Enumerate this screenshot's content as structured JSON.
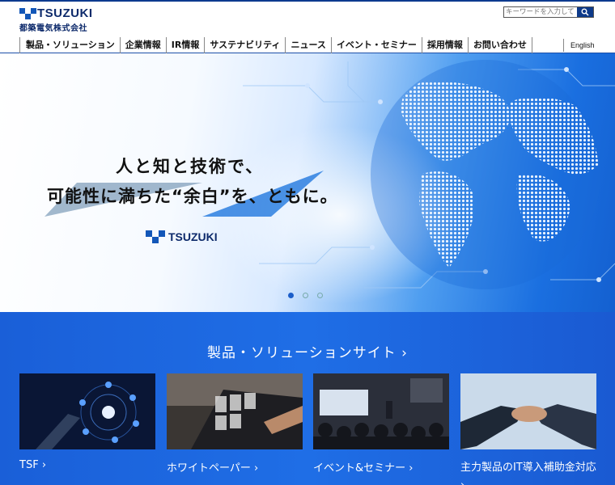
{
  "header": {
    "logo_text": "TSUZUKI",
    "logo_subtext": "都築電気株式会社",
    "search_placeholder": "キーワードを入力してください",
    "nav": [
      {
        "label": "製品・ソリューション"
      },
      {
        "label": "企業情報"
      },
      {
        "label": "IR情報"
      },
      {
        "label": "サステナビリティ"
      },
      {
        "label": "ニュース"
      },
      {
        "label": "イベント・セミナー"
      },
      {
        "label": "採用情報"
      },
      {
        "label": "お問い合わせ"
      }
    ],
    "language_link": "English"
  },
  "hero": {
    "headline_line1": "人と知と技術で、",
    "headline_line2": "可能性に満ちた“余白”を、ともに。",
    "logo_text": "TSUZUKI",
    "slides_total": 3,
    "active_slide": 1
  },
  "products": {
    "heading": "製品・ソリューションサイト",
    "chevron": "›",
    "cards": [
      {
        "label": "TSF",
        "image": "digital-network-hand"
      },
      {
        "label": "ホワイトペーパー",
        "image": "laptop-documents"
      },
      {
        "label": "イベント&セミナー",
        "image": "seminar-audience"
      },
      {
        "label": "主力製品のIT導入補助金対応",
        "image": "handshake"
      }
    ]
  },
  "colors": {
    "brand_navy": "#0d2a6b",
    "brand_blue": "#1357b8",
    "section_blue": "#1f6ee6"
  }
}
